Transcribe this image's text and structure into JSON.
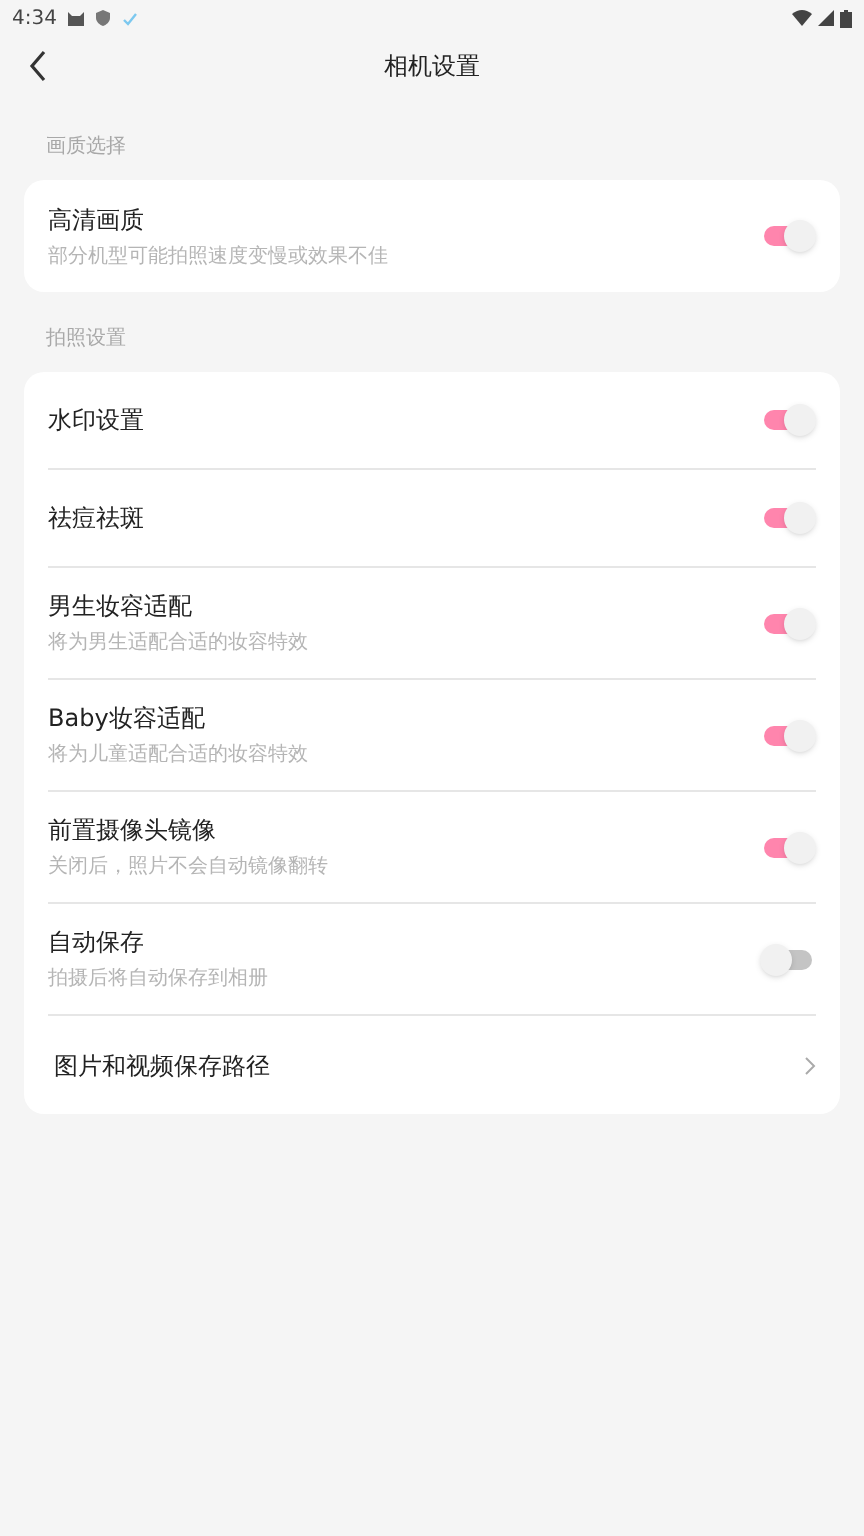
{
  "status_bar": {
    "time": "4:34"
  },
  "header": {
    "title": "相机设置"
  },
  "sections": [
    {
      "label": "画质选择",
      "items": [
        {
          "kind": "toggle",
          "title": "高清画质",
          "subtitle": "部分机型可能拍照速度变慢或效果不佳",
          "on": true
        }
      ]
    },
    {
      "label": "拍照设置",
      "items": [
        {
          "kind": "toggle",
          "title": "水印设置",
          "on": true
        },
        {
          "kind": "toggle",
          "title": "祛痘祛斑",
          "on": true
        },
        {
          "kind": "toggle",
          "title": "男生妆容适配",
          "subtitle": "将为男生适配合适的妆容特效",
          "on": true
        },
        {
          "kind": "toggle",
          "title": "Baby妆容适配",
          "subtitle": "将为儿童适配合适的妆容特效",
          "on": true
        },
        {
          "kind": "toggle",
          "title": "前置摄像头镜像",
          "subtitle": "关闭后，照片不会自动镜像翻转",
          "on": true
        },
        {
          "kind": "toggle",
          "title": "自动保存",
          "subtitle": "拍摄后将自动保存到相册",
          "on": false
        },
        {
          "kind": "link",
          "title": "图片和视频保存路径"
        }
      ]
    }
  ]
}
